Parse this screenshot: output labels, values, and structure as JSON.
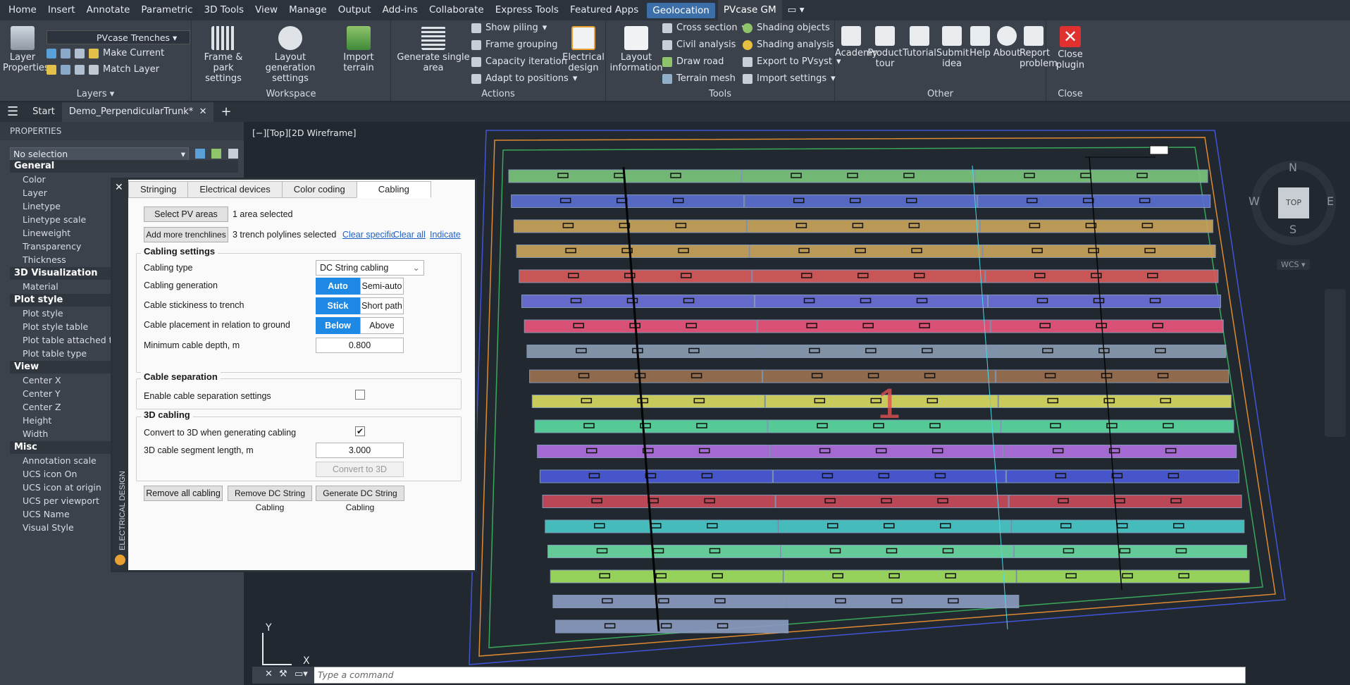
{
  "menubar": {
    "items": [
      "Home",
      "Insert",
      "Annotate",
      "Parametric",
      "3D Tools",
      "View",
      "Manage",
      "Output",
      "Add-ins",
      "Collaborate",
      "Express Tools",
      "Featured Apps",
      "Geolocation",
      "PVcase GM"
    ],
    "active": "Geolocation"
  },
  "ribbon": {
    "layers": {
      "label": "Layers",
      "layer_properties": "Layer Properties",
      "layer_dropdown": "PVcase Trenches",
      "make_current": "Make Current",
      "match_layer": "Match Layer"
    },
    "workspace": {
      "label": "Workspace",
      "frame_park": "Frame & park settings",
      "layout_generation": "Layout generation settings",
      "import_terrain": "Import terrain"
    },
    "actions": {
      "label": "Actions",
      "generate_single": "Generate single area",
      "show_piling": "Show piling",
      "frame_grouping": "Frame grouping",
      "capacity_iteration": "Capacity iteration",
      "adapt_positions": "Adapt to positions",
      "electrical_design": "Electrical design"
    },
    "tools": {
      "label": "Tools",
      "layout_information": "Layout information",
      "cross_section": "Cross section",
      "civil_analysis": "Civil analysis",
      "draw_road": "Draw road",
      "terrain_mesh": "Terrain mesh",
      "shading_objects": "Shading objects",
      "shading_analysis": "Shading analysis",
      "export_pvsyst": "Export to PVsyst",
      "import_settings": "Import settings"
    },
    "other": {
      "label": "Other",
      "academy": "Academy",
      "product_tour": "Product tour",
      "tutorial": "Tutorial",
      "submit_idea": "Submit idea",
      "help": "Help",
      "about": "About",
      "report_problem": "Report problem"
    },
    "close": {
      "label": "Close",
      "close_plugin": "Close plugin"
    }
  },
  "tabs": {
    "start": "Start",
    "active": "Demo_PerpendicularTrunk*",
    "add": "+"
  },
  "properties": {
    "title": "PROPERTIES",
    "selection": "No selection",
    "sections": [
      {
        "name": "General",
        "rows": [
          "Color",
          "Layer",
          "Linetype",
          "Linetype scale",
          "Lineweight",
          "Transparency",
          "Thickness"
        ]
      },
      {
        "name": "3D Visualization",
        "rows": [
          "Material"
        ]
      },
      {
        "name": "Plot style",
        "rows": [
          "Plot style",
          "Plot style table",
          "Plot table attached to",
          "Plot table type"
        ]
      },
      {
        "name": "View",
        "rows": [
          "Center X",
          "Center Y",
          "Center Z",
          "Height",
          "Width"
        ]
      },
      {
        "name": "Misc",
        "rows": [
          "Annotation scale",
          "UCS icon On",
          "UCS icon at origin",
          "UCS per viewport",
          "UCS Name",
          "Visual Style"
        ]
      }
    ]
  },
  "electrical_panel": {
    "side_label": "ELECTRICAL DESIGN",
    "tabs": [
      "Stringing",
      "Electrical devices",
      "Color coding",
      "Cabling"
    ],
    "active_tab": "Cabling",
    "select_pv": "Select PV areas",
    "pv_status": "1 area selected",
    "add_trench": "Add more trenchlines",
    "trench_status": "3 trench polylines selected",
    "clear_specific": "Clear specific",
    "clear_all": "Clear all",
    "indicate": "Indicate",
    "cabling_settings": "Cabling settings",
    "cabling_type_label": "Cabling type",
    "cabling_type_value": "DC String cabling",
    "cabling_generation_label": "Cabling generation",
    "gen_auto": "Auto",
    "gen_semi": "Semi-auto",
    "stickiness_label": "Cable stickiness to trench",
    "stick": "Stick",
    "short_path": "Short path",
    "placement_label": "Cable placement in relation to ground",
    "below": "Below",
    "above": "Above",
    "depth_label": "Minimum cable depth, m",
    "depth_value": "0.800",
    "cable_separation": "Cable separation",
    "enable_sep": "Enable cable separation settings",
    "cabling_3d": "3D cabling",
    "convert_3d_label": "Convert to 3D when generating cabling",
    "seg_len_label": "3D cable segment length, m",
    "seg_len_value": "3.000",
    "convert_3d_btn": "Convert to 3D",
    "remove_all": "Remove all cabling",
    "remove_dc": "Remove DC String Cabling",
    "generate_dc": "Generate DC String Cabling"
  },
  "viewport": {
    "label": "[−][Top][2D Wireframe]",
    "area_number": "1",
    "command_placeholder": "Type a command",
    "ucs_y": "Y",
    "ucs_x": "X"
  },
  "viewcube": {
    "n": "N",
    "s": "S",
    "e": "E",
    "w": "W",
    "top": "TOP",
    "wcs": "WCS"
  },
  "row_colors": [
    "#7ac47a",
    "#5a6fd0",
    "#c8a25a",
    "#c8a25a",
    "#d85a5a",
    "#6a6fd8",
    "#e8557a",
    "#8a9ab0",
    "#9a7050",
    "#d8d860",
    "#5ad8a0",
    "#b070e0",
    "#4a5ad8",
    "#c84a5a",
    "#4ac8c8",
    "#6ad8a0",
    "#a0e060",
    "#8a9ac0",
    "#8a9ac0"
  ]
}
